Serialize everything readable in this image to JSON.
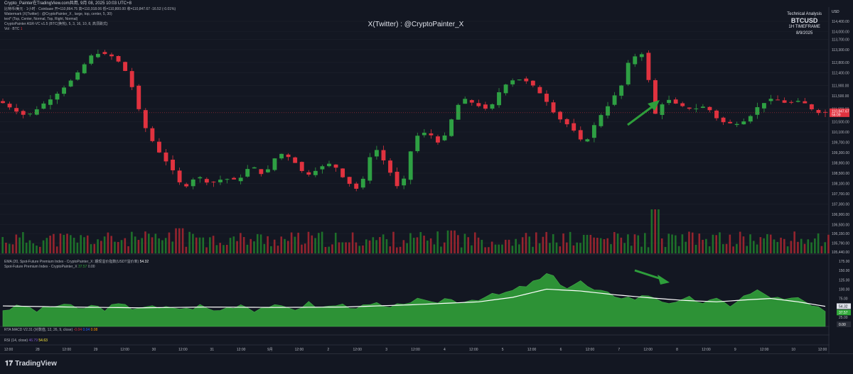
{
  "header_line": "Crypto_Painter在TradingView.com共用, 9月 08, 2025 10:03 UTC+8",
  "legend": {
    "main": "比特币/美元 · 1小时 · Coinbase  开=110,864.75  高=110,918.06  低=110,800.00  收=110,847.67 -16.52 (-0.01%)",
    "watermark_cfg": "Watermark (X(Twitter) : @CryptoPainter_X , large, top, center, 5, 30)",
    "text_cfg": "text* (Top, Center, Normal, Top, Right, Normal)",
    "asr": "CryptoPainter ASR-VC v1.5 (BTC(换热), 5, 3, 16, 10, 8, 高须跌式)",
    "vol": "Vol · BTC",
    "vol_val": "1",
    "ema": "EMA (20, Spot-Future Premium Index - CryptoPainter_X: 期现溢价指数(USDT溢价率)",
    "ema_val": "54.32",
    "spi": "Spot-Future Premium Index - CryptoPainter_X",
    "spi_val": "37.57",
    "spi_val2": "0.00",
    "macd": "RTA MACD V2.31 (对数值, 12, 26, 9, close)",
    "macd_v1": "-0.04",
    "macd_v2": "0.04",
    "macd_v3": "0.08",
    "rsi": "RSI (14, close)",
    "rsi_v1": "46.79",
    "rsi_v2": "54.63"
  },
  "watermark": "X(Twitter) : @CryptoPainter_X",
  "analysis": {
    "title": "Technical Analysis",
    "symbol": "BTCUSD",
    "timeframe": "1H TIMEFRAME",
    "date": "8/9/2025"
  },
  "brand": "TradingView",
  "brand_icon": "tradingview-logo-icon",
  "chart_data": {
    "type": "candlestick",
    "currency": "USD",
    "price_ticks": [
      "114,400.00",
      "114,000.00",
      "113,700.00",
      "113,300.00",
      "112,800.00",
      "112,400.00",
      "111,900.00",
      "111,500.00",
      "111,000.00",
      "110,500.00",
      "110,100.00",
      "109,700.00",
      "109,300.00",
      "108,900.00",
      "108,500.00",
      "108,100.00",
      "107,700.00",
      "107,300.00",
      "106,900.00",
      "106,500.00",
      "106,150.00",
      "105,790.00",
      "105,440.00"
    ],
    "price_range": [
      105440,
      114400
    ],
    "last_price": "110,847.67",
    "last_countdown": "56:09",
    "x_ticks": [
      "12:00",
      "28",
      "12:00",
      "29",
      "12:00",
      "30",
      "12:00",
      "31",
      "12:00",
      "9月",
      "12:00",
      "2",
      "12:00",
      "3",
      "12:00",
      "4",
      "12:00",
      "5",
      "12:00",
      "6",
      "12:00",
      "7",
      "12:00",
      "8",
      "12:00",
      "9",
      "12:00",
      "10",
      "12:00"
    ],
    "price_path": [
      [
        0,
        111300
      ],
      [
        4,
        110700
      ],
      [
        8,
        111500
      ],
      [
        11,
        112200
      ],
      [
        13,
        112900
      ],
      [
        14,
        113200
      ],
      [
        17,
        113000
      ],
      [
        19,
        112300
      ],
      [
        21,
        110500
      ],
      [
        23,
        109500
      ],
      [
        25,
        108800
      ],
      [
        27,
        107900
      ],
      [
        29,
        108400
      ],
      [
        31,
        108100
      ],
      [
        33,
        108300
      ],
      [
        35,
        108200
      ],
      [
        37,
        108800
      ],
      [
        39,
        108400
      ],
      [
        41,
        109300
      ],
      [
        43,
        109100
      ],
      [
        45,
        108400
      ],
      [
        47,
        108700
      ],
      [
        49,
        108900
      ],
      [
        51,
        108200
      ],
      [
        53,
        107800
      ],
      [
        55,
        109600
      ],
      [
        57,
        108800
      ],
      [
        59,
        107700
      ],
      [
        61,
        109900
      ],
      [
        63,
        110100
      ],
      [
        65,
        109600
      ],
      [
        67,
        110900
      ],
      [
        68,
        111400
      ],
      [
        70,
        111200
      ],
      [
        72,
        110900
      ],
      [
        74,
        111900
      ],
      [
        76,
        112200
      ],
      [
        78,
        112000
      ],
      [
        80,
        111500
      ],
      [
        82,
        110700
      ],
      [
        84,
        110300
      ],
      [
        86,
        109600
      ],
      [
        88,
        110600
      ],
      [
        90,
        111300
      ],
      [
        92,
        112100
      ],
      [
        93,
        113400
      ],
      [
        94,
        112700
      ],
      [
        95,
        113600
      ],
      [
        96,
        110600
      ],
      [
        98,
        111400
      ],
      [
        100,
        111100
      ],
      [
        102,
        111000
      ],
      [
        104,
        111100
      ],
      [
        106,
        110500
      ],
      [
        108,
        110400
      ],
      [
        110,
        110600
      ],
      [
        112,
        111200
      ],
      [
        114,
        111400
      ],
      [
        116,
        111200
      ],
      [
        118,
        111300
      ],
      [
        120,
        110900
      ],
      [
        121,
        110847
      ]
    ],
    "spi_ticks": [
      "175.00",
      "150.00",
      "125.00",
      "100.00",
      "75.00",
      "50.00",
      "25.00"
    ],
    "spi_range": [
      0,
      175
    ],
    "ema_last": "54.32",
    "spi_last": "37.57",
    "spi_zero": "0.00",
    "spi_path": [
      [
        0,
        45
      ],
      [
        3,
        55
      ],
      [
        5,
        42
      ],
      [
        7,
        52
      ],
      [
        9,
        60
      ],
      [
        11,
        45
      ],
      [
        13,
        55
      ],
      [
        15,
        48
      ],
      [
        17,
        58
      ],
      [
        19,
        50
      ],
      [
        21,
        55
      ],
      [
        23,
        47
      ],
      [
        25,
        52
      ],
      [
        27,
        46
      ],
      [
        29,
        56
      ],
      [
        31,
        42
      ],
      [
        33,
        50
      ],
      [
        35,
        60
      ],
      [
        37,
        45
      ],
      [
        39,
        55
      ],
      [
        41,
        50
      ],
      [
        43,
        48
      ],
      [
        45,
        62
      ],
      [
        47,
        50
      ],
      [
        49,
        58
      ],
      [
        51,
        55
      ],
      [
        53,
        52
      ],
      [
        55,
        60
      ],
      [
        57,
        45
      ],
      [
        59,
        65
      ],
      [
        61,
        70
      ],
      [
        63,
        60
      ],
      [
        65,
        75
      ],
      [
        67,
        68
      ],
      [
        69,
        72
      ],
      [
        71,
        80
      ],
      [
        73,
        85
      ],
      [
        75,
        95
      ],
      [
        77,
        110
      ],
      [
        79,
        125
      ],
      [
        80,
        140
      ],
      [
        81,
        130
      ],
      [
        83,
        105
      ],
      [
        85,
        120
      ],
      [
        87,
        95
      ],
      [
        89,
        88
      ],
      [
        91,
        80
      ],
      [
        93,
        75
      ],
      [
        95,
        85
      ],
      [
        97,
        70
      ],
      [
        99,
        60
      ],
      [
        101,
        75
      ],
      [
        103,
        65
      ],
      [
        105,
        70
      ],
      [
        107,
        58
      ],
      [
        109,
        80
      ],
      [
        111,
        95
      ],
      [
        113,
        80
      ],
      [
        115,
        70
      ],
      [
        117,
        75
      ],
      [
        119,
        55
      ],
      [
        121,
        37
      ]
    ],
    "ema_path": [
      [
        0,
        55
      ],
      [
        10,
        52
      ],
      [
        20,
        50
      ],
      [
        30,
        52
      ],
      [
        40,
        51
      ],
      [
        50,
        52
      ],
      [
        60,
        58
      ],
      [
        70,
        66
      ],
      [
        75,
        78
      ],
      [
        80,
        100
      ],
      [
        85,
        95
      ],
      [
        90,
        85
      ],
      [
        95,
        77
      ],
      [
        100,
        70
      ],
      [
        105,
        66
      ],
      [
        110,
        72
      ],
      [
        113,
        75
      ],
      [
        117,
        66
      ],
      [
        121,
        54
      ]
    ],
    "volume_scale": [
      0,
      100
    ],
    "volume_hints": [
      [
        26,
        57
      ],
      [
        29,
        36
      ],
      [
        50,
        25
      ],
      [
        66,
        52
      ],
      [
        86,
        42
      ],
      [
        96,
        100
      ],
      [
        73,
        20
      ]
    ],
    "annotations": [
      {
        "type": "arrow",
        "direction": "up",
        "color": "#2e9e3b"
      },
      {
        "type": "arrow",
        "direction": "down",
        "color": "#2e9e3b"
      }
    ],
    "colors": {
      "up": "#26a69a",
      "up_candle": "#2ea043",
      "down": "#e0323f",
      "spi_fill": "#32a83a",
      "ema": "#ffffff"
    }
  }
}
